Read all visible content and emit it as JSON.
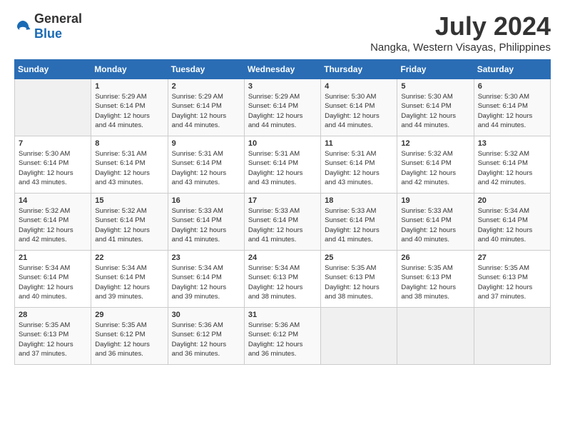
{
  "logo": {
    "general": "General",
    "blue": "Blue"
  },
  "title": {
    "month_year": "July 2024",
    "location": "Nangka, Western Visayas, Philippines"
  },
  "calendar": {
    "days_of_week": [
      "Sunday",
      "Monday",
      "Tuesday",
      "Wednesday",
      "Thursday",
      "Friday",
      "Saturday"
    ],
    "weeks": [
      [
        {
          "day": "",
          "content": ""
        },
        {
          "day": "1",
          "content": "Sunrise: 5:29 AM\nSunset: 6:14 PM\nDaylight: 12 hours\nand 44 minutes."
        },
        {
          "day": "2",
          "content": "Sunrise: 5:29 AM\nSunset: 6:14 PM\nDaylight: 12 hours\nand 44 minutes."
        },
        {
          "day": "3",
          "content": "Sunrise: 5:29 AM\nSunset: 6:14 PM\nDaylight: 12 hours\nand 44 minutes."
        },
        {
          "day": "4",
          "content": "Sunrise: 5:30 AM\nSunset: 6:14 PM\nDaylight: 12 hours\nand 44 minutes."
        },
        {
          "day": "5",
          "content": "Sunrise: 5:30 AM\nSunset: 6:14 PM\nDaylight: 12 hours\nand 44 minutes."
        },
        {
          "day": "6",
          "content": "Sunrise: 5:30 AM\nSunset: 6:14 PM\nDaylight: 12 hours\nand 44 minutes."
        }
      ],
      [
        {
          "day": "7",
          "content": "Sunrise: 5:30 AM\nSunset: 6:14 PM\nDaylight: 12 hours\nand 43 minutes."
        },
        {
          "day": "8",
          "content": "Sunrise: 5:31 AM\nSunset: 6:14 PM\nDaylight: 12 hours\nand 43 minutes."
        },
        {
          "day": "9",
          "content": "Sunrise: 5:31 AM\nSunset: 6:14 PM\nDaylight: 12 hours\nand 43 minutes."
        },
        {
          "day": "10",
          "content": "Sunrise: 5:31 AM\nSunset: 6:14 PM\nDaylight: 12 hours\nand 43 minutes."
        },
        {
          "day": "11",
          "content": "Sunrise: 5:31 AM\nSunset: 6:14 PM\nDaylight: 12 hours\nand 43 minutes."
        },
        {
          "day": "12",
          "content": "Sunrise: 5:32 AM\nSunset: 6:14 PM\nDaylight: 12 hours\nand 42 minutes."
        },
        {
          "day": "13",
          "content": "Sunrise: 5:32 AM\nSunset: 6:14 PM\nDaylight: 12 hours\nand 42 minutes."
        }
      ],
      [
        {
          "day": "14",
          "content": "Sunrise: 5:32 AM\nSunset: 6:14 PM\nDaylight: 12 hours\nand 42 minutes."
        },
        {
          "day": "15",
          "content": "Sunrise: 5:32 AM\nSunset: 6:14 PM\nDaylight: 12 hours\nand 41 minutes."
        },
        {
          "day": "16",
          "content": "Sunrise: 5:33 AM\nSunset: 6:14 PM\nDaylight: 12 hours\nand 41 minutes."
        },
        {
          "day": "17",
          "content": "Sunrise: 5:33 AM\nSunset: 6:14 PM\nDaylight: 12 hours\nand 41 minutes."
        },
        {
          "day": "18",
          "content": "Sunrise: 5:33 AM\nSunset: 6:14 PM\nDaylight: 12 hours\nand 41 minutes."
        },
        {
          "day": "19",
          "content": "Sunrise: 5:33 AM\nSunset: 6:14 PM\nDaylight: 12 hours\nand 40 minutes."
        },
        {
          "day": "20",
          "content": "Sunrise: 5:34 AM\nSunset: 6:14 PM\nDaylight: 12 hours\nand 40 minutes."
        }
      ],
      [
        {
          "day": "21",
          "content": "Sunrise: 5:34 AM\nSunset: 6:14 PM\nDaylight: 12 hours\nand 40 minutes."
        },
        {
          "day": "22",
          "content": "Sunrise: 5:34 AM\nSunset: 6:14 PM\nDaylight: 12 hours\nand 39 minutes."
        },
        {
          "day": "23",
          "content": "Sunrise: 5:34 AM\nSunset: 6:14 PM\nDaylight: 12 hours\nand 39 minutes."
        },
        {
          "day": "24",
          "content": "Sunrise: 5:34 AM\nSunset: 6:13 PM\nDaylight: 12 hours\nand 38 minutes."
        },
        {
          "day": "25",
          "content": "Sunrise: 5:35 AM\nSunset: 6:13 PM\nDaylight: 12 hours\nand 38 minutes."
        },
        {
          "day": "26",
          "content": "Sunrise: 5:35 AM\nSunset: 6:13 PM\nDaylight: 12 hours\nand 38 minutes."
        },
        {
          "day": "27",
          "content": "Sunrise: 5:35 AM\nSunset: 6:13 PM\nDaylight: 12 hours\nand 37 minutes."
        }
      ],
      [
        {
          "day": "28",
          "content": "Sunrise: 5:35 AM\nSunset: 6:13 PM\nDaylight: 12 hours\nand 37 minutes."
        },
        {
          "day": "29",
          "content": "Sunrise: 5:35 AM\nSunset: 6:12 PM\nDaylight: 12 hours\nand 36 minutes."
        },
        {
          "day": "30",
          "content": "Sunrise: 5:36 AM\nSunset: 6:12 PM\nDaylight: 12 hours\nand 36 minutes."
        },
        {
          "day": "31",
          "content": "Sunrise: 5:36 AM\nSunset: 6:12 PM\nDaylight: 12 hours\nand 36 minutes."
        },
        {
          "day": "",
          "content": ""
        },
        {
          "day": "",
          "content": ""
        },
        {
          "day": "",
          "content": ""
        }
      ]
    ]
  }
}
